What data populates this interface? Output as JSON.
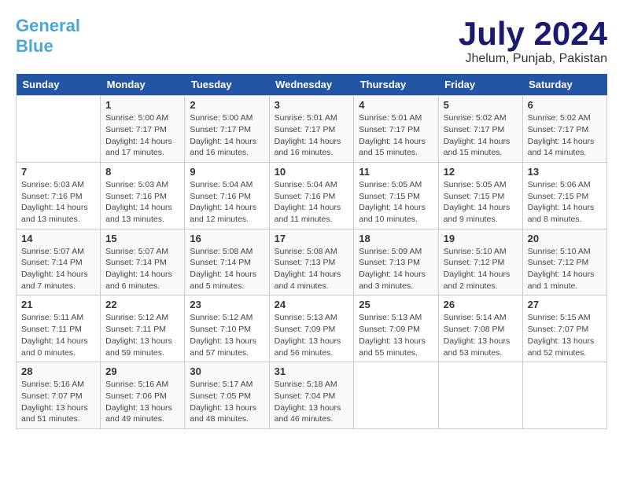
{
  "header": {
    "logo_general": "General",
    "logo_blue": "Blue",
    "month_year": "July 2024",
    "location": "Jhelum, Punjab, Pakistan"
  },
  "days_of_week": [
    "Sunday",
    "Monday",
    "Tuesday",
    "Wednesday",
    "Thursday",
    "Friday",
    "Saturday"
  ],
  "weeks": [
    [
      {
        "day": "",
        "info": ""
      },
      {
        "day": "1",
        "info": "Sunrise: 5:00 AM\nSunset: 7:17 PM\nDaylight: 14 hours\nand 17 minutes."
      },
      {
        "day": "2",
        "info": "Sunrise: 5:00 AM\nSunset: 7:17 PM\nDaylight: 14 hours\nand 16 minutes."
      },
      {
        "day": "3",
        "info": "Sunrise: 5:01 AM\nSunset: 7:17 PM\nDaylight: 14 hours\nand 16 minutes."
      },
      {
        "day": "4",
        "info": "Sunrise: 5:01 AM\nSunset: 7:17 PM\nDaylight: 14 hours\nand 15 minutes."
      },
      {
        "day": "5",
        "info": "Sunrise: 5:02 AM\nSunset: 7:17 PM\nDaylight: 14 hours\nand 15 minutes."
      },
      {
        "day": "6",
        "info": "Sunrise: 5:02 AM\nSunset: 7:17 PM\nDaylight: 14 hours\nand 14 minutes."
      }
    ],
    [
      {
        "day": "7",
        "info": "Sunrise: 5:03 AM\nSunset: 7:16 PM\nDaylight: 14 hours\nand 13 minutes."
      },
      {
        "day": "8",
        "info": "Sunrise: 5:03 AM\nSunset: 7:16 PM\nDaylight: 14 hours\nand 13 minutes."
      },
      {
        "day": "9",
        "info": "Sunrise: 5:04 AM\nSunset: 7:16 PM\nDaylight: 14 hours\nand 12 minutes."
      },
      {
        "day": "10",
        "info": "Sunrise: 5:04 AM\nSunset: 7:16 PM\nDaylight: 14 hours\nand 11 minutes."
      },
      {
        "day": "11",
        "info": "Sunrise: 5:05 AM\nSunset: 7:15 PM\nDaylight: 14 hours\nand 10 minutes."
      },
      {
        "day": "12",
        "info": "Sunrise: 5:05 AM\nSunset: 7:15 PM\nDaylight: 14 hours\nand 9 minutes."
      },
      {
        "day": "13",
        "info": "Sunrise: 5:06 AM\nSunset: 7:15 PM\nDaylight: 14 hours\nand 8 minutes."
      }
    ],
    [
      {
        "day": "14",
        "info": "Sunrise: 5:07 AM\nSunset: 7:14 PM\nDaylight: 14 hours\nand 7 minutes."
      },
      {
        "day": "15",
        "info": "Sunrise: 5:07 AM\nSunset: 7:14 PM\nDaylight: 14 hours\nand 6 minutes."
      },
      {
        "day": "16",
        "info": "Sunrise: 5:08 AM\nSunset: 7:14 PM\nDaylight: 14 hours\nand 5 minutes."
      },
      {
        "day": "17",
        "info": "Sunrise: 5:08 AM\nSunset: 7:13 PM\nDaylight: 14 hours\nand 4 minutes."
      },
      {
        "day": "18",
        "info": "Sunrise: 5:09 AM\nSunset: 7:13 PM\nDaylight: 14 hours\nand 3 minutes."
      },
      {
        "day": "19",
        "info": "Sunrise: 5:10 AM\nSunset: 7:12 PM\nDaylight: 14 hours\nand 2 minutes."
      },
      {
        "day": "20",
        "info": "Sunrise: 5:10 AM\nSunset: 7:12 PM\nDaylight: 14 hours\nand 1 minute."
      }
    ],
    [
      {
        "day": "21",
        "info": "Sunrise: 5:11 AM\nSunset: 7:11 PM\nDaylight: 14 hours\nand 0 minutes."
      },
      {
        "day": "22",
        "info": "Sunrise: 5:12 AM\nSunset: 7:11 PM\nDaylight: 13 hours\nand 59 minutes."
      },
      {
        "day": "23",
        "info": "Sunrise: 5:12 AM\nSunset: 7:10 PM\nDaylight: 13 hours\nand 57 minutes."
      },
      {
        "day": "24",
        "info": "Sunrise: 5:13 AM\nSunset: 7:09 PM\nDaylight: 13 hours\nand 56 minutes."
      },
      {
        "day": "25",
        "info": "Sunrise: 5:13 AM\nSunset: 7:09 PM\nDaylight: 13 hours\nand 55 minutes."
      },
      {
        "day": "26",
        "info": "Sunrise: 5:14 AM\nSunset: 7:08 PM\nDaylight: 13 hours\nand 53 minutes."
      },
      {
        "day": "27",
        "info": "Sunrise: 5:15 AM\nSunset: 7:07 PM\nDaylight: 13 hours\nand 52 minutes."
      }
    ],
    [
      {
        "day": "28",
        "info": "Sunrise: 5:16 AM\nSunset: 7:07 PM\nDaylight: 13 hours\nand 51 minutes."
      },
      {
        "day": "29",
        "info": "Sunrise: 5:16 AM\nSunset: 7:06 PM\nDaylight: 13 hours\nand 49 minutes."
      },
      {
        "day": "30",
        "info": "Sunrise: 5:17 AM\nSunset: 7:05 PM\nDaylight: 13 hours\nand 48 minutes."
      },
      {
        "day": "31",
        "info": "Sunrise: 5:18 AM\nSunset: 7:04 PM\nDaylight: 13 hours\nand 46 minutes."
      },
      {
        "day": "",
        "info": ""
      },
      {
        "day": "",
        "info": ""
      },
      {
        "day": "",
        "info": ""
      }
    ]
  ]
}
